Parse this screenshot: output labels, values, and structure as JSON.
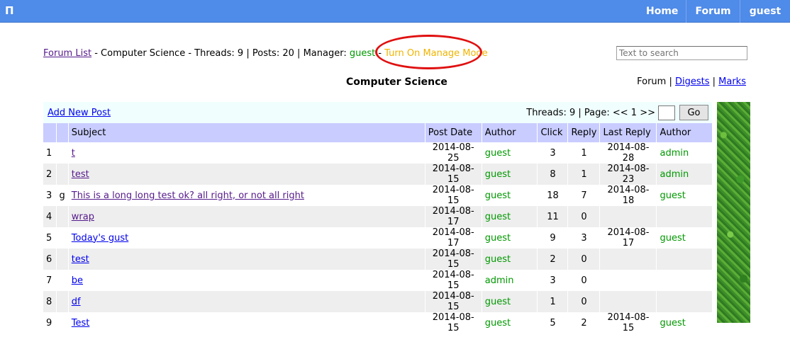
{
  "topbar": {
    "logo": "Π",
    "nav": [
      "Home",
      "Forum",
      "guest"
    ]
  },
  "crumbs": {
    "forum_list": "Forum List",
    "forum_name": "Computer Science",
    "threads_label": "Threads:",
    "threads": "9",
    "posts_label": "Posts:",
    "posts": "20",
    "manager_label": "Manager:",
    "manager": "guest",
    "manage_mode": "Turn On Manage Mode"
  },
  "search": {
    "placeholder": "Text to search"
  },
  "title": "Computer Science",
  "views": {
    "forum": "Forum",
    "digests": "Digests",
    "marks": "Marks"
  },
  "toolbar": {
    "add_post": "Add New Post",
    "pager_text": "Threads: 9 | Page: << 1 >>",
    "go": "Go"
  },
  "table": {
    "headers": {
      "num": "",
      "flag": "",
      "subject": "Subject",
      "date": "Post Date",
      "author": "Author",
      "click": "Click",
      "reply": "Reply",
      "last": "Last Reply",
      "lauthor": "Author"
    },
    "rows": [
      {
        "num": "1",
        "flag": "",
        "subject": "t",
        "date": "2014-08-25",
        "author": "guest",
        "click": "3",
        "reply": "1",
        "last": "2014-08-28",
        "lauthor": "admin"
      },
      {
        "num": "2",
        "flag": "",
        "subject": "test",
        "date": "2014-08-15",
        "author": "guest",
        "click": "8",
        "reply": "1",
        "last": "2014-08-23",
        "lauthor": "admin"
      },
      {
        "num": "3",
        "flag": "g",
        "subject": "This is a long long test ok? all right, or not all right",
        "date": "2014-08-15",
        "author": "guest",
        "click": "18",
        "reply": "7",
        "last": "2014-08-18",
        "lauthor": "guest"
      },
      {
        "num": "4",
        "flag": "",
        "subject": "wrap",
        "date": "2014-08-17",
        "author": "guest",
        "click": "11",
        "reply": "0",
        "last": "",
        "lauthor": ""
      },
      {
        "num": "5",
        "flag": "",
        "subject": "Today's gust",
        "date": "2014-08-17",
        "author": "guest",
        "click": "9",
        "reply": "3",
        "last": "2014-08-17",
        "lauthor": "guest"
      },
      {
        "num": "6",
        "flag": "",
        "subject": "test",
        "date": "2014-08-15",
        "author": "guest",
        "click": "2",
        "reply": "0",
        "last": "",
        "lauthor": ""
      },
      {
        "num": "7",
        "flag": "",
        "subject": "be",
        "date": "2014-08-15",
        "author": "admin",
        "click": "3",
        "reply": "0",
        "last": "",
        "lauthor": ""
      },
      {
        "num": "8",
        "flag": "",
        "subject": "df",
        "date": "2014-08-15",
        "author": "guest",
        "click": "1",
        "reply": "0",
        "last": "",
        "lauthor": ""
      },
      {
        "num": "9",
        "flag": "",
        "subject": "Test",
        "date": "2014-08-15",
        "author": "guest",
        "click": "5",
        "reply": "2",
        "last": "2014-08-15",
        "lauthor": "guest"
      }
    ]
  },
  "colors": {
    "topbar": "#4f8be8",
    "header_row": "#c8ccff",
    "author_green": "#009900",
    "manage_mode": "#f0b400",
    "annotation_ellipse": "#e01010"
  },
  "icons": {
    "leaf_strip": "foliage-image"
  }
}
